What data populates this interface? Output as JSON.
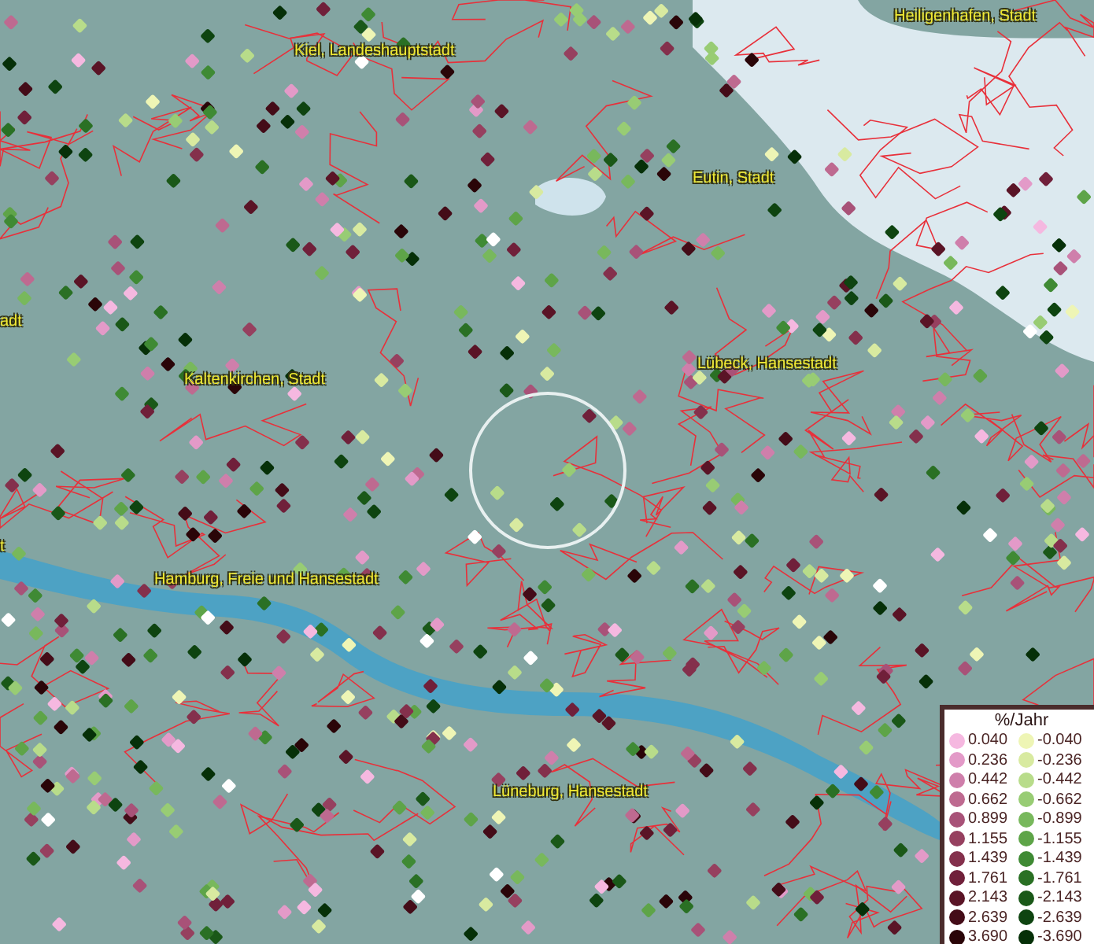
{
  "map": {
    "places": [
      {
        "name": "Heiligenhafen, Stadt"
      },
      {
        "name": "Kiel, Landeshauptstadt"
      },
      {
        "name": "Eutin, Stadt"
      },
      {
        "name": "adt"
      },
      {
        "name": "Lübeck, Hansestadt"
      },
      {
        "name": "Kaltenkirchen, Stadt"
      },
      {
        "name": "t"
      },
      {
        "name": "Hamburg, Freie und Hansestadt"
      },
      {
        "name": "Lüneburg, Hansestadt"
      }
    ]
  },
  "legend": {
    "title": "%/Jahr",
    "rows": [
      {
        "positive": {
          "label": "0.040",
          "color": "#f5b8e0"
        },
        "negative": {
          "label": "-0.040",
          "color": "#eef5b5"
        }
      },
      {
        "positive": {
          "label": "0.236",
          "color": "#e39ac8"
        },
        "negative": {
          "label": "-0.236",
          "color": "#d8eaa0"
        }
      },
      {
        "positive": {
          "label": "0.442",
          "color": "#cf7fab"
        },
        "negative": {
          "label": "-0.442",
          "color": "#b8dc8a"
        }
      },
      {
        "positive": {
          "label": "0.662",
          "color": "#be6a90"
        },
        "negative": {
          "label": "-0.662",
          "color": "#98cc74"
        }
      },
      {
        "positive": {
          "label": "0.899",
          "color": "#a85278"
        },
        "negative": {
          "label": "-0.899",
          "color": "#78b85c"
        }
      },
      {
        "positive": {
          "label": "1.155",
          "color": "#96405f"
        },
        "negative": {
          "label": "-1.155",
          "color": "#5ea448"
        }
      },
      {
        "positive": {
          "label": "1.439",
          "color": "#84304c"
        },
        "negative": {
          "label": "-1.439",
          "color": "#3f8a34"
        }
      },
      {
        "positive": {
          "label": "1.761",
          "color": "#70203a"
        },
        "negative": {
          "label": "-1.761",
          "color": "#2a7024"
        }
      },
      {
        "positive": {
          "label": "2.143",
          "color": "#5a1426"
        },
        "negative": {
          "label": "-2.143",
          "color": "#1a5818"
        }
      },
      {
        "positive": {
          "label": "2.639",
          "color": "#440c18"
        },
        "negative": {
          "label": "-2.639",
          "color": "#0e4410"
        }
      },
      {
        "positive": {
          "label": "3.690",
          "color": "#2a0508"
        },
        "negative": {
          "label": "-3.690",
          "color": "#063008"
        }
      }
    ]
  }
}
